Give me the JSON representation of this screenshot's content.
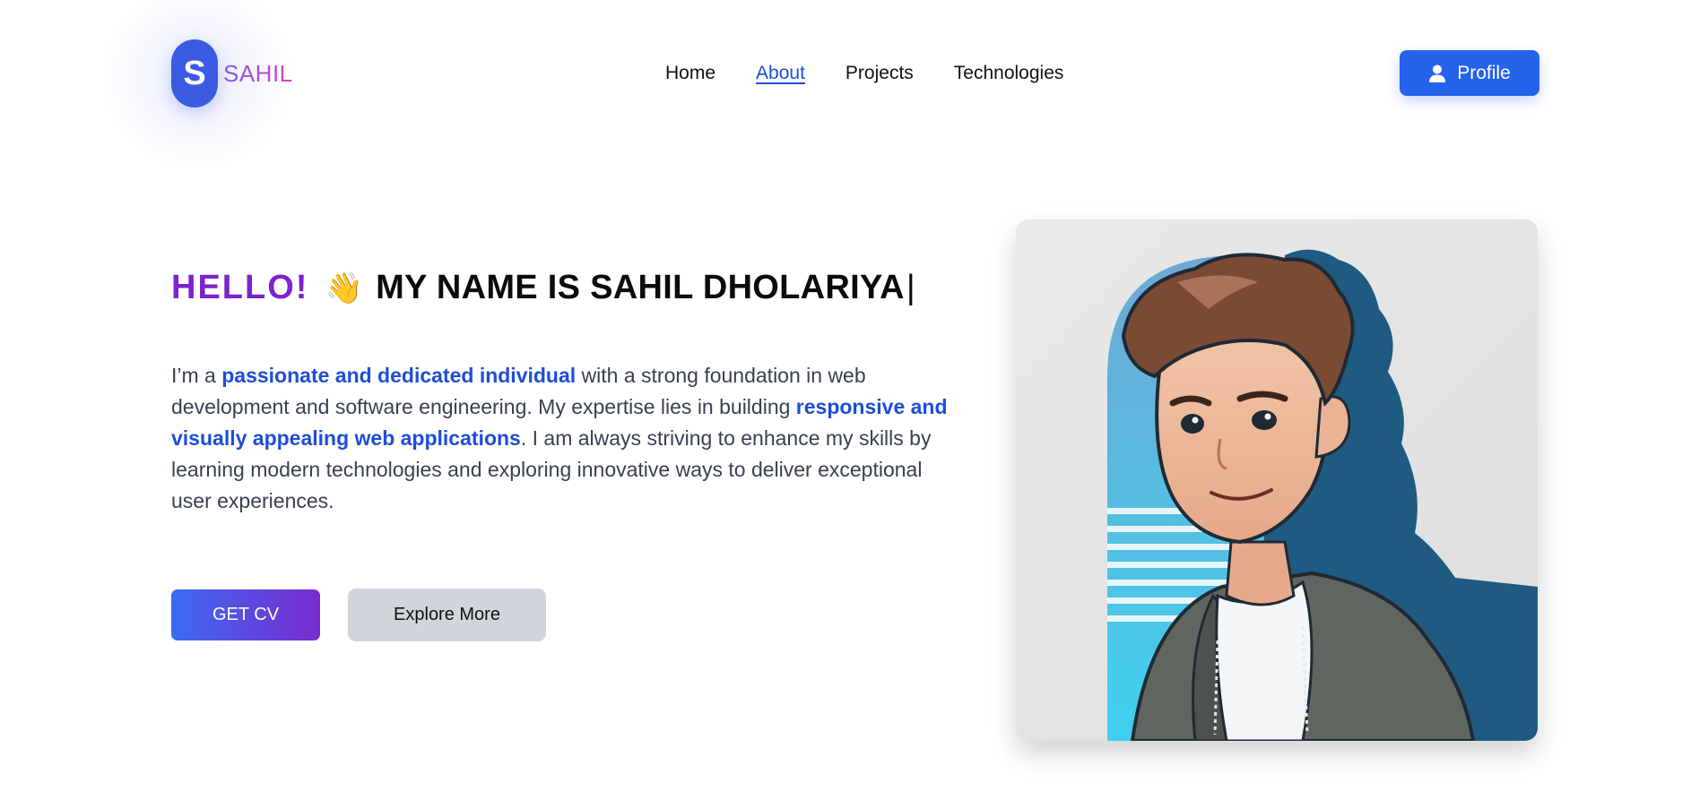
{
  "logo": {
    "initial": "S",
    "name": "SAHIL"
  },
  "nav": {
    "items": [
      {
        "label": "Home",
        "active": false
      },
      {
        "label": "About",
        "active": true
      },
      {
        "label": "Projects",
        "active": false
      },
      {
        "label": "Technologies",
        "active": false
      }
    ]
  },
  "header": {
    "profile_label": "Profile",
    "profile_icon": "user-icon"
  },
  "hero": {
    "hello": "HELLO!",
    "wave_emoji": "👋",
    "name_line": "MY NAME IS SAHIL DHOLARIYA",
    "caret": "|",
    "intro_1": "I’m a ",
    "intro_hl_1": "passionate and dedicated individual",
    "intro_2": " with a strong foundation in web development and software engineering. My expertise lies in building ",
    "intro_hl_2": "responsive and visually appealing web applications",
    "intro_3": ". I am always striving to enhance my skills by learning modern technologies and exploring innovative ways to deliver exceptional user experiences.",
    "cv_button": "GET CV",
    "explore_button": "Explore More"
  },
  "colors": {
    "brand": "#3b5be3",
    "primary": "#2563eb",
    "hello": "#7e22ce",
    "highlight": "#1d4ed8",
    "explore_bg": "#d1d5db"
  }
}
